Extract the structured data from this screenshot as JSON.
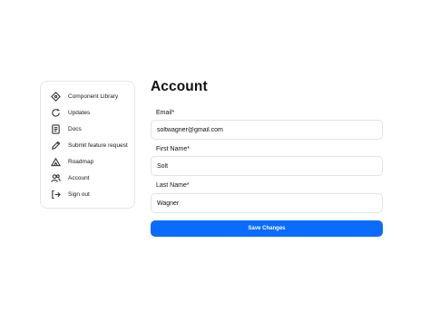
{
  "sidebar": {
    "items": [
      {
        "label": "Component Library",
        "icon": "diamond-icon"
      },
      {
        "label": "Updates",
        "icon": "refresh-icon"
      },
      {
        "label": "Docs",
        "icon": "document-icon"
      },
      {
        "label": "Submit feature request",
        "icon": "pencil-icon"
      },
      {
        "label": "Roadmap",
        "icon": "mountain-icon"
      },
      {
        "label": "Account",
        "icon": "users-icon"
      },
      {
        "label": "Sign out",
        "icon": "sign-out-icon"
      }
    ]
  },
  "main": {
    "title": "Account",
    "fields": {
      "email": {
        "label": "Email*",
        "value": "soltwagner@gmail.com"
      },
      "first_name": {
        "label": "First Name*",
        "value": "Solt"
      },
      "last_name": {
        "label": "Last Name*",
        "value": "Wagner"
      }
    },
    "save_label": "Save Changes"
  },
  "colors": {
    "accent": "#0a6cff",
    "border": "#e3e3e3"
  }
}
